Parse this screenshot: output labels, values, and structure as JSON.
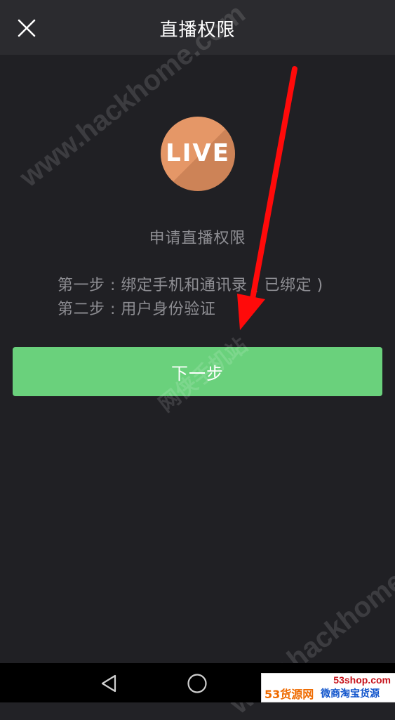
{
  "header": {
    "title": "直播权限",
    "close_icon": "close-icon"
  },
  "main": {
    "logo_text": "LIVE",
    "logo_color": "#e59767",
    "apply_title": "申请直播权限",
    "steps": [
      "第一步 : 绑定手机和通讯录 ( 已绑定 )",
      "第二步 : 用户身份验证"
    ],
    "next_button": "下一步",
    "button_color": "#6ad17c"
  },
  "watermark": {
    "site": "www.hackhome.com",
    "site_cn": "网侠手机站"
  },
  "badge": {
    "url": "53shop.com",
    "left_text": "53货源网",
    "right_text": "微商淘宝货源"
  },
  "navbar": {
    "back_icon": "back-triangle-icon",
    "home_icon": "home-circle-icon",
    "recent_icon": "recent-square-icon"
  },
  "annotation": {
    "arrow_color": "#ff0000"
  }
}
